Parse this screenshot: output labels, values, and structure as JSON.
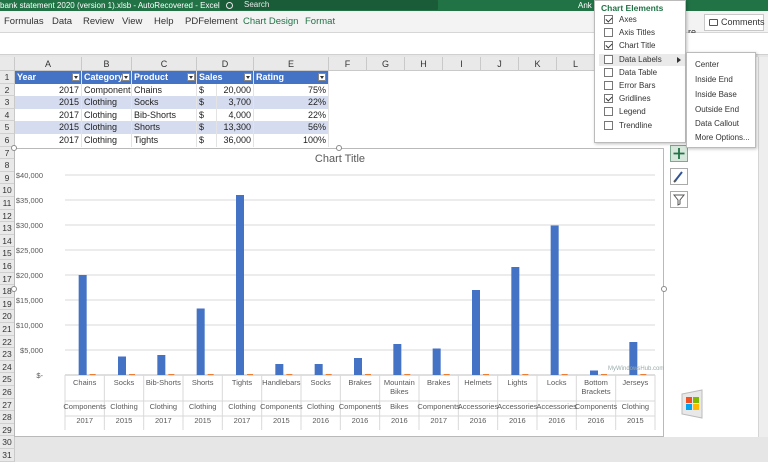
{
  "window": {
    "title": "bank statement 2020 (version 1).xlsb - AutoRecovered - Excel",
    "user": "Ank",
    "search_placeholder": "Search"
  },
  "ribbon": {
    "tabs": [
      "Formulas",
      "Data",
      "Review",
      "View",
      "Help",
      "PDFelement",
      "Chart Design",
      "Format"
    ],
    "share": "re",
    "comments": "Comments"
  },
  "sheet": {
    "columns": [
      "A",
      "B",
      "C",
      "D",
      "E",
      "F",
      "G",
      "H",
      "I",
      "J",
      "K",
      "L"
    ],
    "rows": [
      "1",
      "2",
      "3",
      "4",
      "5",
      "6",
      "7",
      "8",
      "9",
      "10",
      "11",
      "12",
      "13",
      "14",
      "15",
      "16",
      "17",
      "18",
      "19",
      "20",
      "21",
      "22",
      "23",
      "24",
      "25",
      "26",
      "27",
      "28",
      "29",
      "30",
      "31"
    ],
    "table": {
      "headers": [
        "Year",
        "Category",
        "Product",
        "Sales",
        "Rating"
      ],
      "rows": [
        {
          "year": "2017",
          "category": "Components",
          "product": "Chains",
          "currency": "$",
          "sales": "20,000",
          "rating": "75%"
        },
        {
          "year": "2015",
          "category": "Clothing",
          "product": "Socks",
          "currency": "$",
          "sales": "3,700",
          "rating": "22%"
        },
        {
          "year": "2017",
          "category": "Clothing",
          "product": "Bib-Shorts",
          "currency": "$",
          "sales": "4,000",
          "rating": "22%"
        },
        {
          "year": "2015",
          "category": "Clothing",
          "product": "Shorts",
          "currency": "$",
          "sales": "13,300",
          "rating": "56%"
        },
        {
          "year": "2017",
          "category": "Clothing",
          "product": "Tights",
          "currency": "$",
          "sales": "36,000",
          "rating": "100%"
        }
      ]
    }
  },
  "chart_elements": {
    "title": "Chart Elements",
    "items": [
      {
        "label": "Axes",
        "checked": true
      },
      {
        "label": "Axis Titles",
        "checked": false
      },
      {
        "label": "Chart Title",
        "checked": true
      },
      {
        "label": "Data Labels",
        "checked": false
      },
      {
        "label": "Data Table",
        "checked": false
      },
      {
        "label": "Error Bars",
        "checked": false
      },
      {
        "label": "Gridlines",
        "checked": true
      },
      {
        "label": "Legend",
        "checked": false
      },
      {
        "label": "Trendline",
        "checked": false
      }
    ],
    "submenu": [
      "Center",
      "Inside End",
      "Inside Base",
      "Outside End",
      "Data Callout",
      "More Options..."
    ]
  },
  "watermark": "MyWindowsHub.com",
  "chart_data": {
    "type": "bar",
    "title": "Chart Title",
    "ylim": [
      0,
      40000
    ],
    "yticks": [
      "$-",
      "$5,000",
      "$10,000",
      "$15,000",
      "$20,000",
      "$25,000",
      "$30,000",
      "$35,000",
      "$40,000"
    ],
    "grid": true,
    "categories": [
      {
        "product": "Chains",
        "category": "Components",
        "year": "2017"
      },
      {
        "product": "Socks",
        "category": "Clothing",
        "year": "2015"
      },
      {
        "product": "Bib-Shorts",
        "category": "Clothing",
        "year": "2017"
      },
      {
        "product": "Shorts",
        "category": "Clothing",
        "year": "2015"
      },
      {
        "product": "Tights",
        "category": "Clothing",
        "year": "2017"
      },
      {
        "product": "Handlebars",
        "category": "Components",
        "year": "2015"
      },
      {
        "product": "Socks",
        "category": "Clothing",
        "year": "2016"
      },
      {
        "product": "Brakes",
        "category": "Components",
        "year": "2016"
      },
      {
        "product": "Mountain Bikes",
        "category": "Bikes",
        "year": "2016"
      },
      {
        "product": "Brakes",
        "category": "Components",
        "year": "2017"
      },
      {
        "product": "Helmets",
        "category": "Accessories",
        "year": "2016"
      },
      {
        "product": "Lights",
        "category": "Accessories",
        "year": "2016"
      },
      {
        "product": "Locks",
        "category": "Accessories",
        "year": "2016"
      },
      {
        "product": "Bottom Brackets",
        "category": "Components",
        "year": "2016"
      },
      {
        "product": "Jerseys",
        "category": "Clothing",
        "year": "2015"
      }
    ],
    "series": [
      {
        "values": [
          20000,
          3700,
          4000,
          13300,
          36000,
          2200,
          2200,
          3400,
          6200,
          5300,
          17000,
          21600,
          29900,
          900,
          6600
        ],
        "color": "#4472c4"
      },
      {
        "values": [
          0.75,
          0.22,
          0.22,
          0.56,
          1.0,
          0.3,
          0.3,
          0.3,
          0.3,
          0.3,
          0.3,
          0.3,
          0.3,
          0.3,
          0.3
        ],
        "color": "#ed7d31"
      }
    ]
  }
}
